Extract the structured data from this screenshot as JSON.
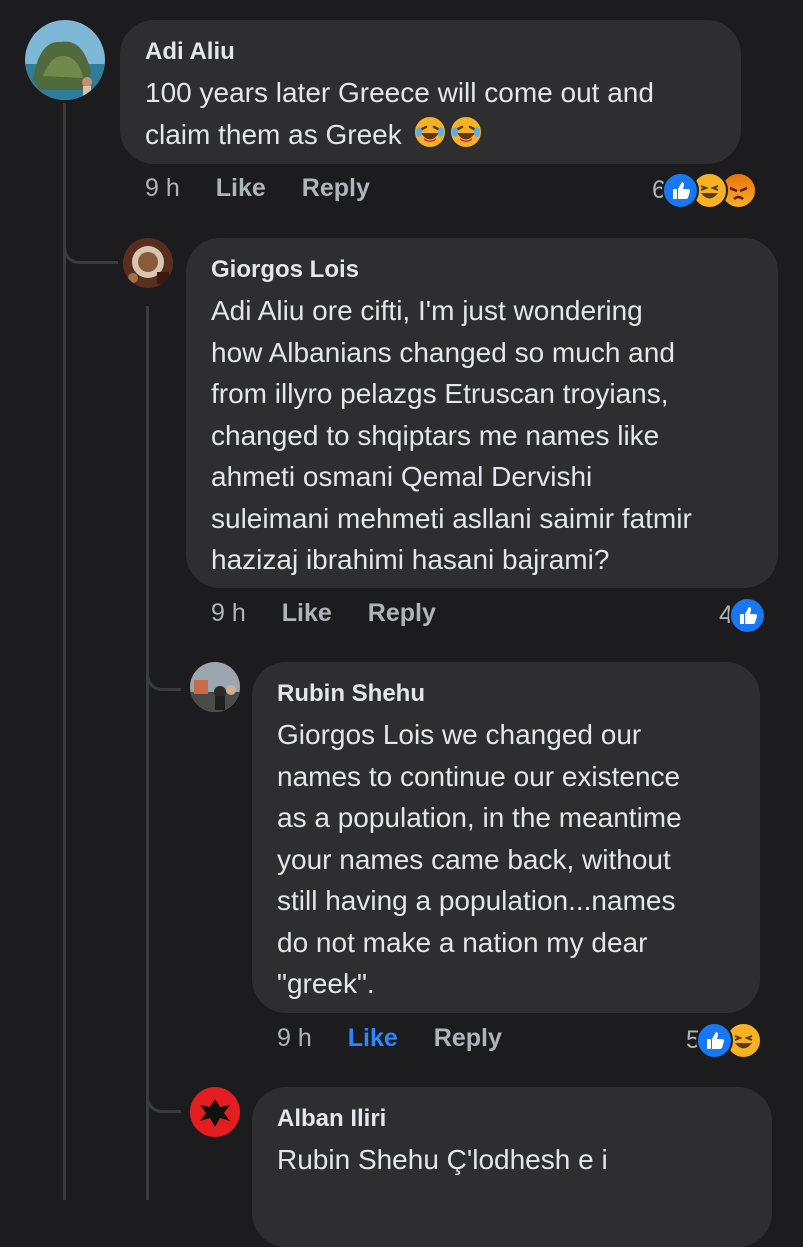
{
  "comments": [
    {
      "author": "Adi Aliu",
      "text": "100 years later Greece will come out and claim them as Greek",
      "emoji_suffix": "😂😂",
      "time": "9 h",
      "like_label": "Like",
      "reply_label": "Reply",
      "reaction_count": "6",
      "reactions": [
        "like-icon",
        "haha-icon",
        "angry-icon"
      ]
    },
    {
      "author": "Giorgos Lois",
      "text_lines": [
        "Adi Aliu ore cifti, I'm just wondering",
        "how Albanians changed so much and",
        "from illyro pelazgs Etruscan troyians,",
        "changed to shqiptars me names like",
        "ahmeti osmani Qemal Dervishi",
        "suleimani mehmeti asllani saimir fatmir",
        "hazizaj ibrahimi hasani bajrami?"
      ],
      "time": "9 h",
      "like_label": "Like",
      "reply_label": "Reply",
      "reaction_count": "4",
      "reactions": [
        "like-icon"
      ]
    },
    {
      "author": "Rubin Shehu",
      "text_lines": [
        "Giorgos Lois we changed our",
        "names to continue our existence",
        "as a population, in the meantime",
        "your names came back, without",
        "still having a population...names",
        "do not make a nation my dear",
        "\"greek\"."
      ],
      "time": "9 h",
      "like_label": "Like",
      "like_active": true,
      "reply_label": "Reply",
      "reaction_count": "5",
      "reactions": [
        "like-icon",
        "haha-icon"
      ]
    },
    {
      "author": "Alban Iliri",
      "text_lines": [
        "Rubin Shehu Ç'lodhesh e i"
      ]
    }
  ],
  "colors": {
    "background": "#1c1c1e",
    "bubble": "#2e2e30",
    "text": "#e4e6eb",
    "secondary_text": "#b0b3b8",
    "like_active": "#2d88ff",
    "thread_line": "#3a3b3c"
  }
}
